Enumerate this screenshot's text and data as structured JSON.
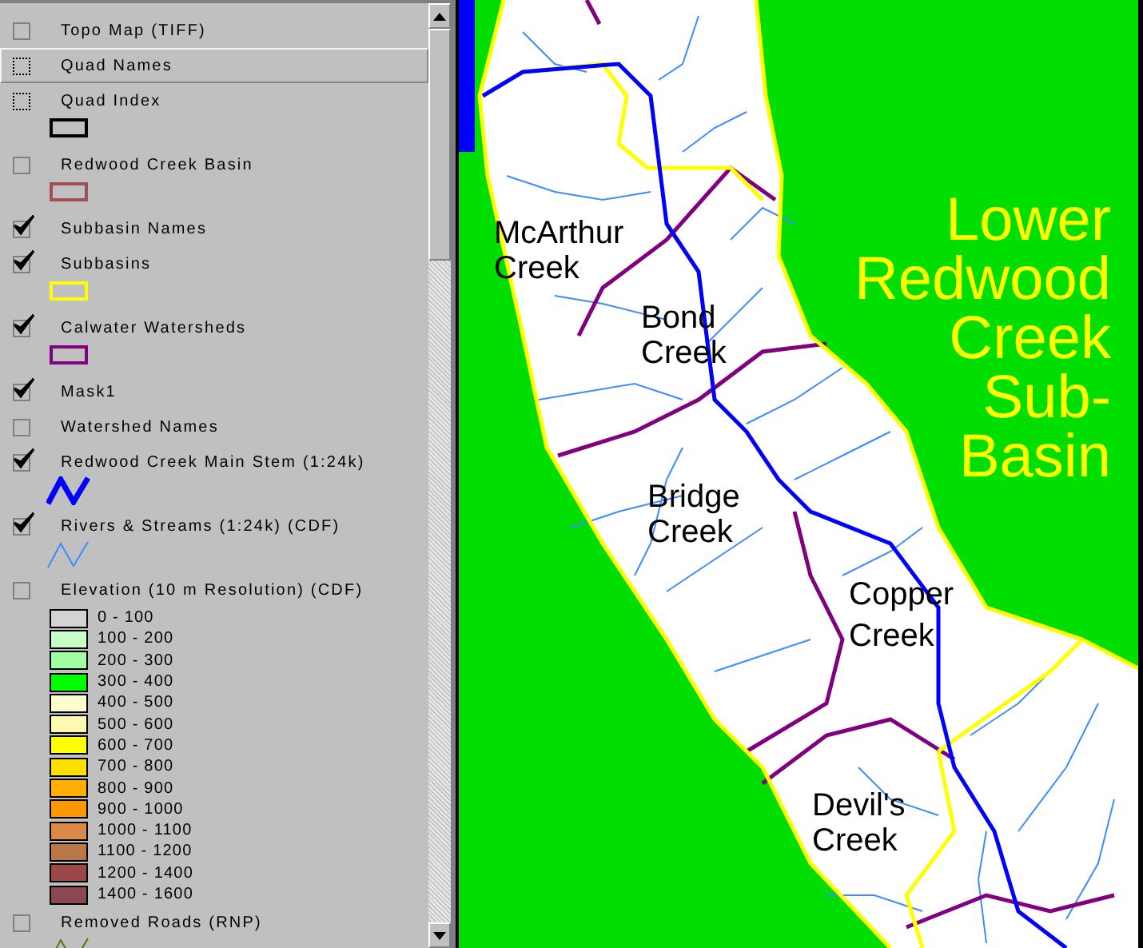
{
  "legend": {
    "layers": [
      {
        "label": "Topo Map (TIFF)",
        "checkbox": {
          "kind": "solid",
          "checked": false
        },
        "selected": false,
        "kind": "plain"
      },
      {
        "label": "Quad Names",
        "checkbox": {
          "kind": "dotted",
          "checked": false
        },
        "selected": true,
        "kind": "plain"
      },
      {
        "label": "Quad Index",
        "checkbox": {
          "kind": "dotted",
          "checked": false
        },
        "selected": false,
        "kind": "box",
        "color": "#000000"
      },
      {
        "label": "Redwood Creek Basin",
        "checkbox": {
          "kind": "solid",
          "checked": false
        },
        "selected": false,
        "kind": "box",
        "color": "#a05050"
      },
      {
        "label": "Subbasin Names",
        "checkbox": {
          "kind": "solid",
          "checked": true
        },
        "selected": false,
        "kind": "plain"
      },
      {
        "label": "Subbasins",
        "checkbox": {
          "kind": "solid",
          "checked": true
        },
        "selected": false,
        "kind": "box",
        "color": "#ffff00"
      },
      {
        "label": "Calwater Watersheds",
        "checkbox": {
          "kind": "solid",
          "checked": true
        },
        "selected": false,
        "kind": "box",
        "color": "#800080"
      },
      {
        "label": "Mask1",
        "checkbox": {
          "kind": "solid",
          "checked": true
        },
        "selected": false,
        "kind": "plain"
      },
      {
        "label": "Watershed Names",
        "checkbox": {
          "kind": "solid",
          "checked": false
        },
        "selected": false,
        "kind": "plain"
      },
      {
        "label": "Redwood Creek Main Stem (1:24k)",
        "checkbox": {
          "kind": "solid",
          "checked": true
        },
        "selected": false,
        "kind": "bold-line",
        "color": "#0000ff"
      },
      {
        "label": "Rivers & Streams (1:24k) (CDF)",
        "checkbox": {
          "kind": "solid",
          "checked": true
        },
        "selected": false,
        "kind": "line",
        "color": "#3c8cff"
      },
      {
        "label": "Elevation (10 m Resolution) (CDF)",
        "checkbox": {
          "kind": "solid",
          "checked": false
        },
        "selected": false,
        "kind": "ramp",
        "classes": [
          {
            "label": "0 - 100",
            "color": "#d4d4d4"
          },
          {
            "label": "100 - 200",
            "color": "#c8ffc8"
          },
          {
            "label": "200 - 300",
            "color": "#a0ffa0"
          },
          {
            "label": "300 - 400",
            "color": "#00ff00"
          },
          {
            "label": "400 - 500",
            "color": "#ffffd0"
          },
          {
            "label": "500 - 600",
            "color": "#fff8b0"
          },
          {
            "label": "600 - 700",
            "color": "#ffff00"
          },
          {
            "label": "700 - 800",
            "color": "#ffe000"
          },
          {
            "label": "800 - 900",
            "color": "#ffb000"
          },
          {
            "label": "900 - 1000",
            "color": "#ff9800"
          },
          {
            "label": "1000 - 1100",
            "color": "#dc8848"
          },
          {
            "label": "1100 - 1200",
            "color": "#b87848"
          },
          {
            "label": "1200 - 1400",
            "color": "#9c4848"
          },
          {
            "label": "1400 - 1600",
            "color": "#8c4850"
          }
        ]
      },
      {
        "label": "Removed Roads (RNP)",
        "checkbox": {
          "kind": "solid",
          "checked": false
        },
        "selected": false,
        "kind": "line",
        "color": "#4a7a10"
      }
    ]
  },
  "map": {
    "labels": [
      {
        "kind": "watershed",
        "lines": [
          "McArthur",
          "Creek"
        ]
      },
      {
        "kind": "watershed",
        "lines": [
          "Bond",
          "Creek"
        ]
      },
      {
        "kind": "subbasin",
        "lines": [
          "Lower",
          "Redwood",
          "Creek",
          "Sub-",
          "Basin"
        ]
      },
      {
        "kind": "watershed",
        "lines": [
          "Bridge",
          "Creek"
        ]
      },
      {
        "kind": "watershed",
        "lines": [
          "Copper",
          "Creek"
        ]
      },
      {
        "kind": "watershed",
        "lines": [
          "Devil's",
          "Creek"
        ]
      }
    ]
  }
}
